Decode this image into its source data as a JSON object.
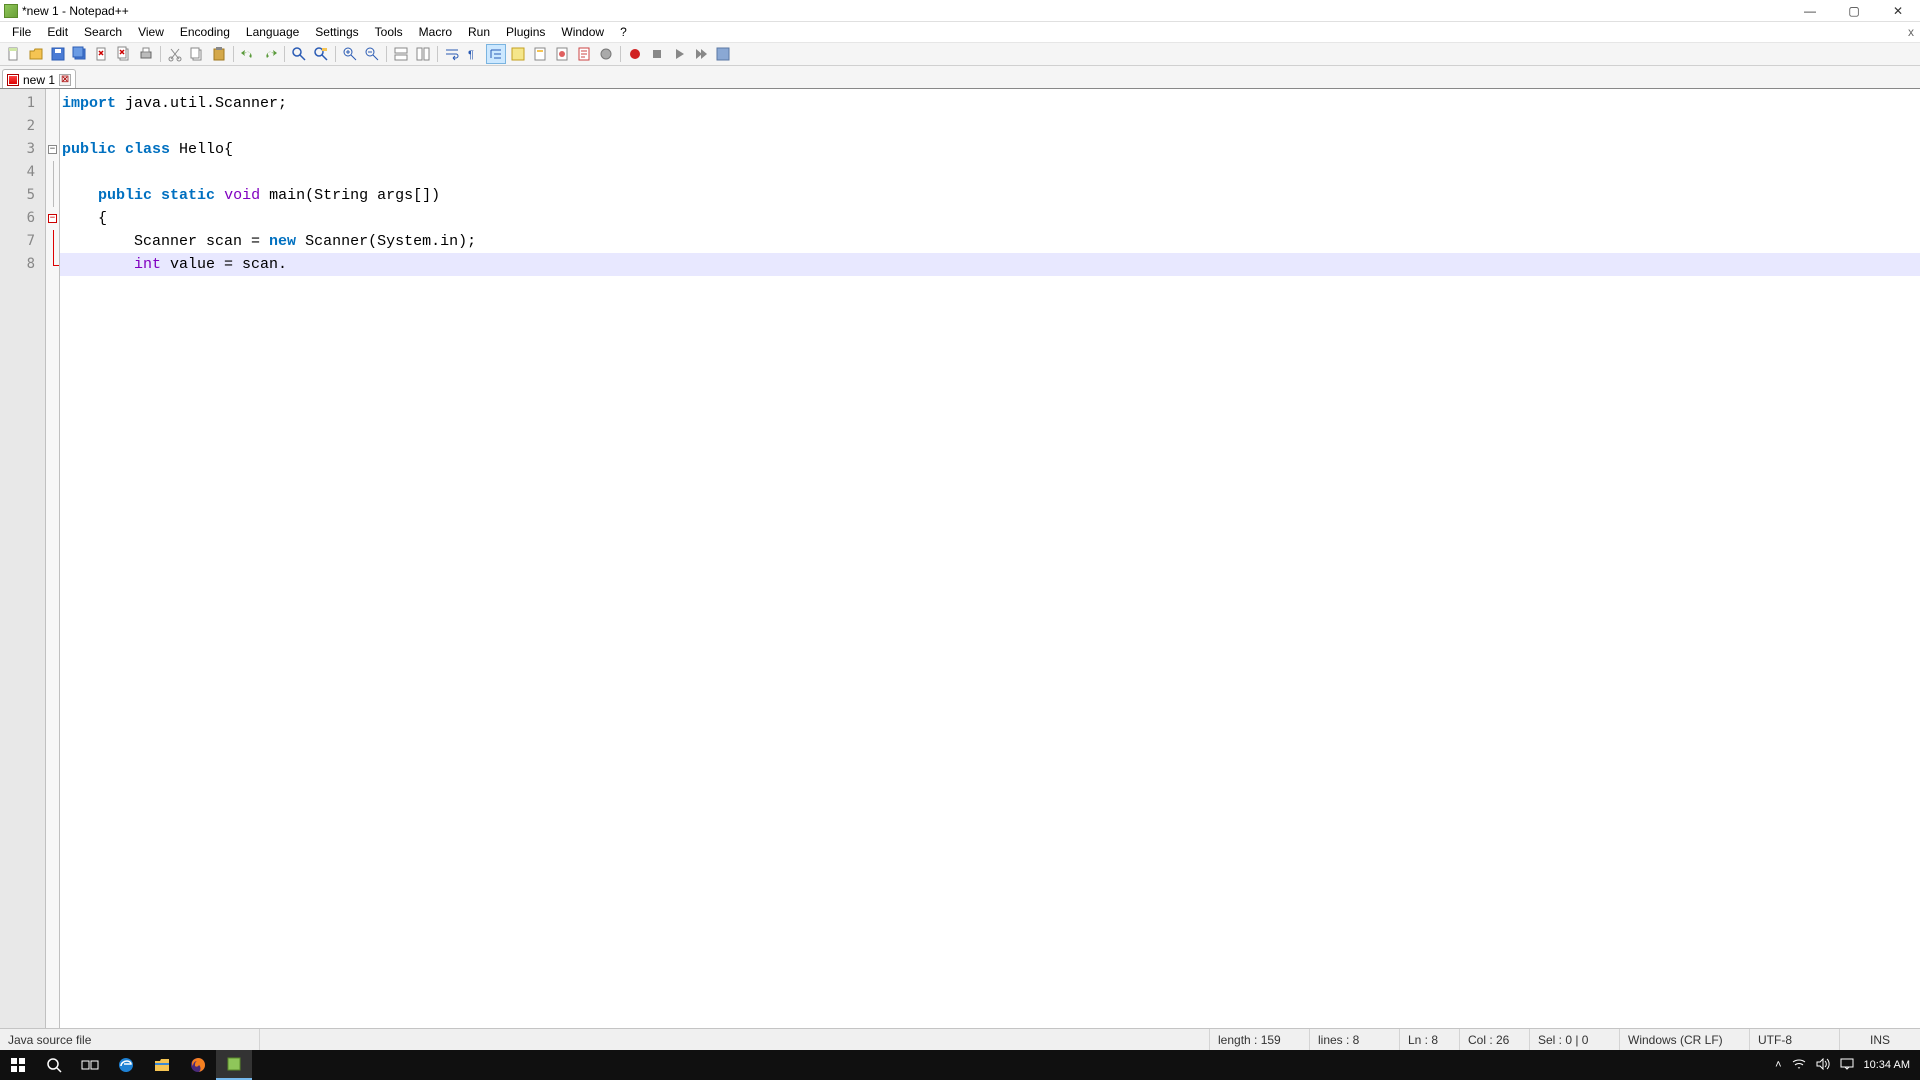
{
  "window": {
    "title": "*new 1 - Notepad++",
    "close_x": "x"
  },
  "menu": {
    "items": [
      "File",
      "Edit",
      "Search",
      "View",
      "Encoding",
      "Language",
      "Settings",
      "Tools",
      "Macro",
      "Run",
      "Plugins",
      "Window",
      "?"
    ]
  },
  "tab": {
    "name": "new 1"
  },
  "code": {
    "lines": [
      {
        "n": 1,
        "tokens": [
          [
            "kw",
            "import"
          ],
          [
            "plain",
            " java.util.Scanner;"
          ]
        ]
      },
      {
        "n": 2,
        "tokens": []
      },
      {
        "n": 3,
        "tokens": [
          [
            "kw",
            "public"
          ],
          [
            "plain",
            " "
          ],
          [
            "kw",
            "class"
          ],
          [
            "plain",
            " Hello{"
          ]
        ]
      },
      {
        "n": 4,
        "tokens": []
      },
      {
        "n": 5,
        "tokens": [
          [
            "plain",
            "    "
          ],
          [
            "kw",
            "public"
          ],
          [
            "plain",
            " "
          ],
          [
            "kw",
            "static"
          ],
          [
            "plain",
            " "
          ],
          [
            "kw2",
            "void"
          ],
          [
            "plain",
            " main(String args[])"
          ]
        ]
      },
      {
        "n": 6,
        "tokens": [
          [
            "plain",
            "    {"
          ]
        ]
      },
      {
        "n": 7,
        "tokens": [
          [
            "plain",
            "        Scanner scan = "
          ],
          [
            "kw",
            "new"
          ],
          [
            "plain",
            " Scanner(System.in);"
          ]
        ]
      },
      {
        "n": 8,
        "tokens": [
          [
            "plain",
            "        "
          ],
          [
            "kw2",
            "int"
          ],
          [
            "plain",
            " value = scan."
          ]
        ],
        "current": true
      }
    ]
  },
  "status": {
    "filetype": "Java source file",
    "length": "length : 159",
    "lines": "lines : 8",
    "ln": "Ln : 8",
    "col": "Col : 26",
    "sel": "Sel : 0 | 0",
    "eol": "Windows (CR LF)",
    "encoding": "UTF-8",
    "ins": "INS"
  },
  "taskbar": {
    "time": "10:34 AM"
  }
}
